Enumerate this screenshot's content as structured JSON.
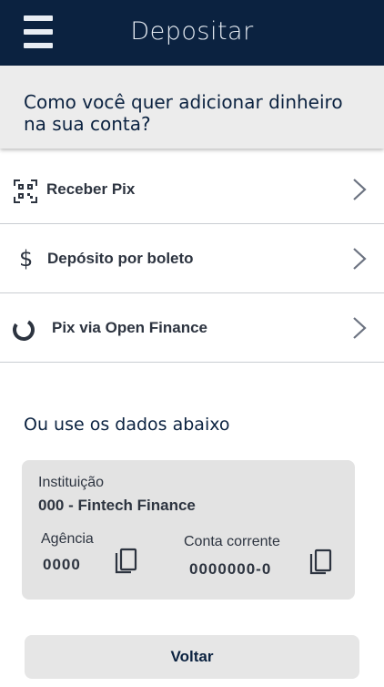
{
  "header": {
    "title": "Depositar",
    "menu_icon": "hamburger-menu-icon"
  },
  "question": "Como você quer adicionar dinheiro na sua conta?",
  "options": [
    {
      "label": "Receber Pix",
      "icon": "qr-code-icon"
    },
    {
      "label": "Depósito por boleto",
      "icon": "dollar-icon"
    },
    {
      "label": "Pix via Open Finance",
      "icon": "open-finance-icon"
    }
  ],
  "alt_section": {
    "title": "Ou use os dados abaixo",
    "institution_label": "Instituição",
    "institution_value": "000 - Fintech Finance",
    "agency_label": "Agência",
    "agency_value": "0000",
    "account_label": "Conta corrente",
    "account_value": "0000000-0"
  },
  "back_button": "Voltar",
  "colors": {
    "header_bg": "#0b2240",
    "accent_text": "#0b2240",
    "card_bg": "#e3e3e3",
    "divider": "#c9cdd2"
  }
}
